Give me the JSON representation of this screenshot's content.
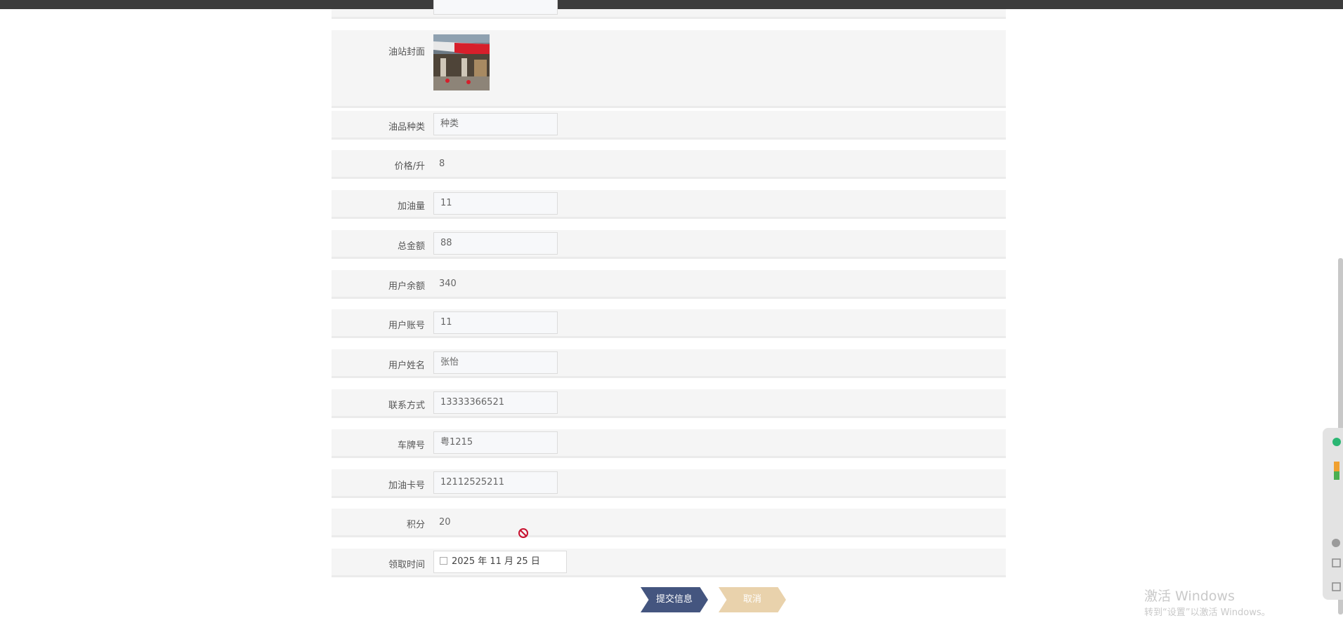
{
  "form": {
    "cover_label": "油站封面",
    "fields": [
      {
        "label": "油品种类",
        "value": "种类",
        "kind": "input"
      },
      {
        "label": "价格/升",
        "value": "8",
        "kind": "text"
      },
      {
        "label": "加油量",
        "value": "11",
        "kind": "input"
      },
      {
        "label": "总金额",
        "value": "88",
        "kind": "input"
      },
      {
        "label": "用户余额",
        "value": "340",
        "kind": "text"
      },
      {
        "label": "用户账号",
        "value": "11",
        "kind": "input"
      },
      {
        "label": "用户姓名",
        "value": "张怡",
        "kind": "input"
      },
      {
        "label": "联系方式",
        "value": "13333366521",
        "kind": "input"
      },
      {
        "label": "车牌号",
        "value": "粤1215",
        "kind": "input"
      },
      {
        "label": "加油卡号",
        "value": "12112525211",
        "kind": "input"
      },
      {
        "label": "积分",
        "value": "20",
        "kind": "text"
      }
    ],
    "date": {
      "label": "领取时间",
      "value": "2025 年 11 月 25 日"
    }
  },
  "buttons": {
    "submit": "提交信息",
    "cancel": "取消"
  },
  "watermark": {
    "line1": "激活 Windows",
    "line2": "转到“设置”以激活 Windows。"
  },
  "colors": {
    "submit": "#44557f",
    "cancel": "#e9d2ac",
    "row_bg": "#f5f5f5"
  }
}
